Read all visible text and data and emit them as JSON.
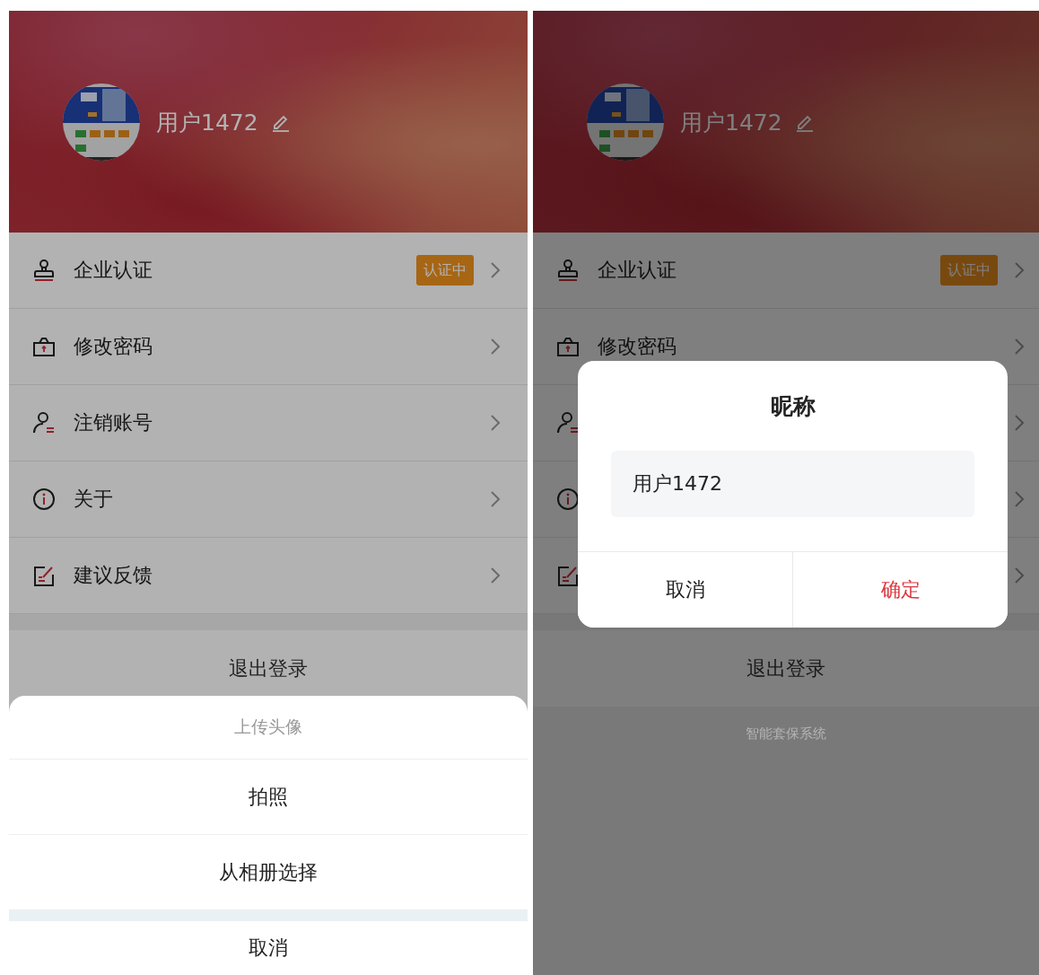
{
  "screens": [
    {
      "profile": {
        "username": "用户1472"
      },
      "menu": [
        {
          "kind": "row",
          "label": "企业认证",
          "badge": "认证中"
        },
        {
          "kind": "row",
          "label": "修改密码"
        },
        {
          "kind": "row",
          "label": "注销账号"
        },
        {
          "kind": "row",
          "label": "关于"
        },
        {
          "kind": "row",
          "label": "建议反馈"
        }
      ],
      "logout": "退出登录",
      "action_sheet": {
        "title": "上传头像",
        "options": [
          "拍照",
          "从相册选择"
        ],
        "cancel": "取消"
      }
    },
    {
      "profile": {
        "username": "用户1472"
      },
      "menu": [
        {
          "kind": "row",
          "label": "企业认证",
          "badge": "认证中"
        },
        {
          "kind": "row",
          "label": "修改密码"
        },
        {
          "kind": "row"
        },
        {
          "kind": "row"
        },
        {
          "kind": "row"
        }
      ],
      "logout": "退出登录",
      "footer": "智能套保系统",
      "dialog": {
        "title": "昵称",
        "value": "用户1472",
        "cancel": "取消",
        "confirm": "确定"
      }
    }
  ]
}
